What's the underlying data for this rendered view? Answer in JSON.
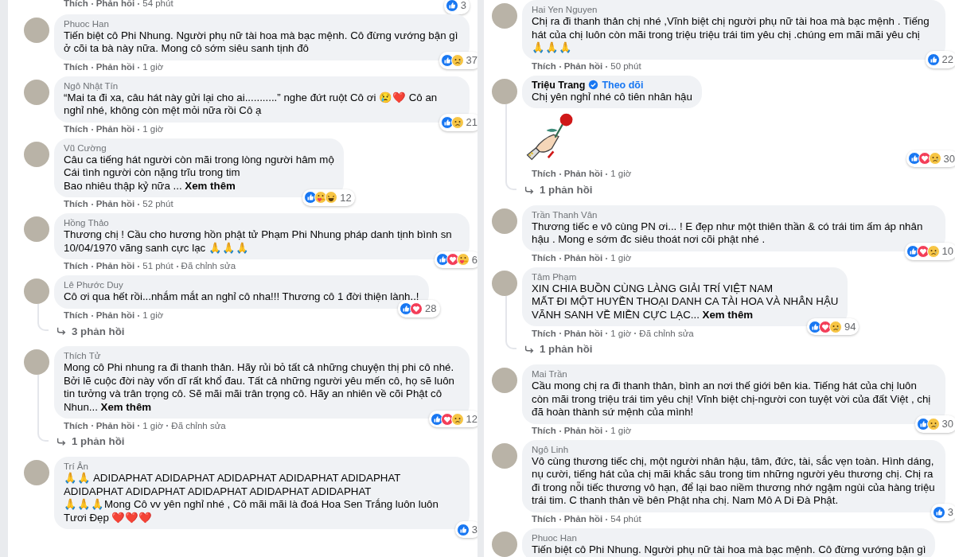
{
  "columns": [
    {
      "comments": [
        {
          "meta": [
            "Thích",
            "Phản hồi",
            "54 phút"
          ],
          "reactions": [
            {
              "kind": "like"
            }
          ],
          "reaction_count": "3"
        },
        {
          "author": "Phuoc Han",
          "text": "Tiến biệt cô Phi Nhung. Người phụ nữ tài hoa mà bạc mệnh. Cô đừng vướng bận gì ở cõi ta bà này nữa. Mong cô sớm siêu sanh tịnh đô",
          "meta": [
            "Thích",
            "Phản hồi",
            "1 giờ"
          ],
          "reactions": [
            {
              "kind": "like"
            },
            {
              "kind": "sad"
            }
          ],
          "reaction_count": "37"
        },
        {
          "author": "Ngô Nhật Tín",
          "text": "“Mai ta đi xa, câu hát này gửi lại cho ai...........” nghe đứt ruột Cô ơi 😢❤️ Cô an nghỉ nhé, không còn mệt mỏi nữa rồi Cô ạ",
          "meta": [
            "Thích",
            "Phản hồi",
            "1 giờ"
          ],
          "reactions": [
            {
              "kind": "like"
            },
            {
              "kind": "sad"
            }
          ],
          "reaction_count": "21"
        },
        {
          "author": "Vũ Cường",
          "text": "Câu ca tiếng hát người còn mãi trong lòng người hâm mộ\nCái tình người còn nặng trĩu trong tim\nBao nhiêu thập kỷ nữa ... **Xem thêm**",
          "meta": [
            "Thích",
            "Phản hồi",
            "52 phút"
          ],
          "reactions": [
            {
              "kind": "like"
            },
            {
              "kind": "care"
            },
            {
              "kind": "haha"
            }
          ],
          "reaction_count": "12"
        },
        {
          "author": "Hồng Thảo",
          "text": "Thương chị ! Cầu cho hương hồn phật tử Phạm Phi Nhung pháp danh tịnh bình sn 10/04/1970 vãng sanh cực lạc 🙏🙏🙏",
          "meta": [
            "Thích",
            "Phản hồi",
            "51 phút",
            "Đã chỉnh sửa"
          ],
          "reactions": [
            {
              "kind": "like"
            },
            {
              "kind": "love"
            },
            {
              "kind": "care"
            }
          ],
          "reaction_count": "6"
        },
        {
          "author": "Lê Phước Duy",
          "text": "Cô ơi qua hết rồi...nhắm mắt an nghỉ cô nha!!! Thương cô 1 đời thiện lành..!",
          "meta": [
            "Thích",
            "Phản hồi",
            "1 giờ"
          ],
          "reactions": [
            {
              "kind": "like"
            },
            {
              "kind": "love"
            }
          ],
          "reaction_count": "28",
          "replies": "3 phản hồi"
        },
        {
          "author": "Thích Tử",
          "text": "Mong cô Phi nhung ra đi thanh thản. Hãy rủi bỏ tất cả những chuyện thị phi cô nhé. Bởi lẽ cuộc đời này vốn dĩ rất khổ đau. Tất cả những người yêu mến cô, họ sẽ luôn tin tưởng và trân trọng cô. Sẽ mãi mãi trân trọng cô. Hãy an nhiên về cõi Phật cô Nhun... **Xem thêm**",
          "meta": [
            "Thích",
            "Phản hồi",
            "1 giờ",
            "Đã chỉnh sửa"
          ],
          "reactions": [
            {
              "kind": "like"
            },
            {
              "kind": "love"
            },
            {
              "kind": "sad"
            }
          ],
          "reaction_count": "12",
          "replies": "1 phản hồi"
        },
        {
          "author": "Trí Ân",
          "text": "🙏🙏 ADIDAPHAT ADIDAPHAT ADIDAPHAT ADIDAPHAT ADIDAPHAT ADIDAPHAT ADIDAPHAT ADIDAPHAT ADIDAPHAT ADIDAPHAT\n🙏🙏🙏Mong Cô vv yên nghỉ nhé , Cô mãi mãi là đoá Hoa Sen Trắng luôn luôn Tươi Đẹp ❤️❤️❤️",
          "reactions": [
            {
              "kind": "like"
            }
          ],
          "reaction_count": "3"
        }
      ]
    },
    {
      "comments": [
        {
          "author": "Hai Yen Nguyen",
          "text": "Chị ra đi thanh thản chị nhé ,Vĩnh biệt chị người phụ nữ tài hoa mà bạc mệnh . Tiếng hát của chị luôn còn mãi trong triệu triệu trái tim yêu chị .chúng em mãi mãi yêu chị 🙏🙏🙏",
          "meta": [
            "Thích",
            "Phản hồi",
            "50 phút"
          ],
          "reactions": [
            {
              "kind": "like"
            }
          ],
          "reaction_count": "22"
        },
        {
          "author": "Triệu Trang",
          "verified": true,
          "follow": "Theo dõi",
          "text": "Chị yên nghỉ nhé cô tiên nhân hậu",
          "sticker": true,
          "meta": [
            "Thích",
            "Phản hồi",
            "1 giờ"
          ],
          "reactions": [
            {
              "kind": "like"
            },
            {
              "kind": "love"
            },
            {
              "kind": "sad"
            }
          ],
          "reaction_count": "30",
          "replies": "1 phản hồi"
        },
        {
          "author": "Trần Thanh Vân",
          "text": "Thương tiếc e vô cùng PN ơi... ! E đẹp như một thiên thần & có trái tim ấm áp nhân hậu . Mong e sớm đc siêu thoát nơi cõi phật nhé .",
          "meta": [
            "Thích",
            "Phản hồi",
            "1 giờ"
          ],
          "reactions": [
            {
              "kind": "like"
            },
            {
              "kind": "love"
            },
            {
              "kind": "sad"
            }
          ],
          "reaction_count": "10"
        },
        {
          "author": "Tâm Phạm",
          "text": "XIN CHIA BUỒN CÙNG LÀNG GIẢI TRÍ VIỆT NAM\nMẤT ĐI MỘT HUYỀN THOẠI DANH CA TÀI HOA VÀ NHÂN HẬU\nVÃNH SANH VỀ MIỀN CỰC LẠC... **Xem thêm**",
          "meta": [
            "Thích",
            "Phản hồi",
            "1 giờ",
            "Đã chỉnh sửa"
          ],
          "reactions": [
            {
              "kind": "like"
            },
            {
              "kind": "love"
            },
            {
              "kind": "sad"
            }
          ],
          "reaction_count": "94",
          "replies": "1 phản hồi"
        },
        {
          "author": "Mai Trần",
          "text": "Cầu mong chị ra đi thanh thản, bình an nơi thế giới bên kia. Tiếng hát của chị luôn còn mãi trong triệu trái tim yêu chị! Vĩnh biệt chị-người con tuyệt vời của đất Việt , chị đã hoàn thành sứ mệnh của mình!",
          "meta": [
            "Thích",
            "Phản hồi",
            "1 giờ"
          ],
          "reactions": [
            {
              "kind": "like"
            },
            {
              "kind": "sad"
            }
          ],
          "reaction_count": "30"
        },
        {
          "author": "Ngô Linh",
          "text": "Vô cùng thương tiếc chị, một người nhân hậu, tâm, đức, tài, sắc vẹn toàn. Hình dáng, nụ cười, tiếng hát của chị mãi khắc sâu trong tim những người yêu thương chị. Chị ra đi trong nỗi tiếc thương vô hạn, để lại bao niềm thương nhớ ngậm ngùi của hàng triệu trái tim. C thanh thản về bên Phật nha chị. Nam Mô A Di Đà Phật.",
          "meta": [
            "Thích",
            "Phản hồi",
            "54 phút"
          ],
          "reactions": [
            {
              "kind": "like"
            }
          ],
          "reaction_count": "3"
        },
        {
          "author": "Phuoc Han",
          "text": "Tiến biệt cô Phi Nhung. Người phụ nữ tài hoa mà bạc mệnh. Cô đừng vướng bận gì"
        }
      ]
    }
  ]
}
